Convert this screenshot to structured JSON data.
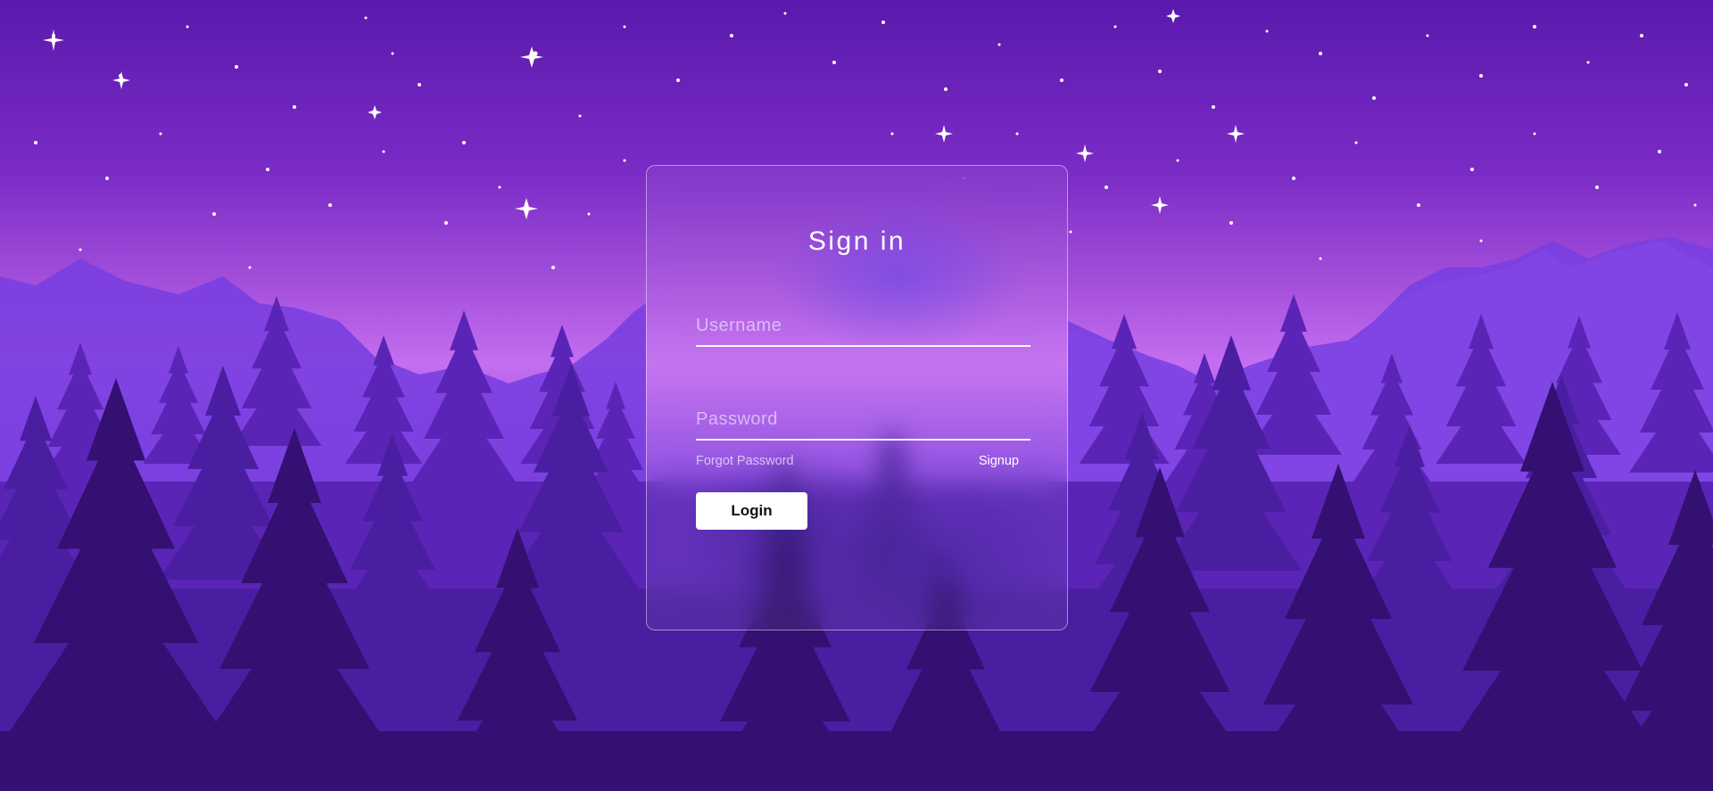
{
  "login": {
    "title": "Sign in",
    "username_placeholder": "Username",
    "username_value": "",
    "password_placeholder": "Password",
    "password_value": "",
    "forgot_label": "Forgot Password",
    "signup_label": "Signup",
    "login_label": "Login"
  },
  "theme": {
    "sky_top": "#5b1cb0",
    "sky_glow": "#c96ff0",
    "forest_dark": "#32106a",
    "button_bg": "#ffffff",
    "text": "#ffffff"
  }
}
